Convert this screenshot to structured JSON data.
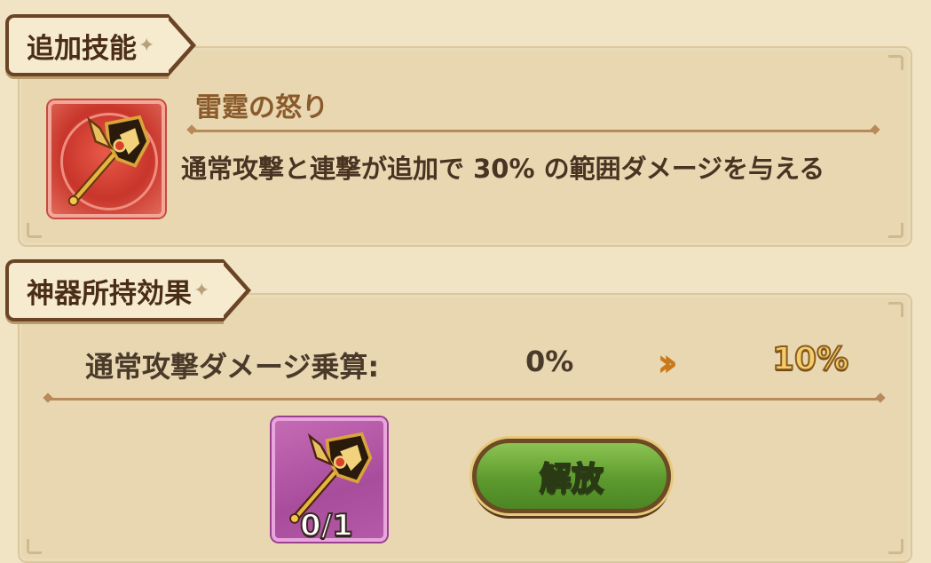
{
  "sections": {
    "skill_title": "追加技能",
    "effect_title": "神器所持効果"
  },
  "skill": {
    "name": "雷霆の怒り",
    "description": "通常攻撃と連撃が追加で 30% の範囲ダメージを与える",
    "icon": "golden-axe-icon"
  },
  "effect": {
    "label": "通常攻撃ダメージ乗算:",
    "current_value": "0%",
    "next_value": "10%",
    "arrow_icon": "double-chevron-right-icon"
  },
  "artifact": {
    "icon": "golden-axe-icon",
    "count": "0/1"
  },
  "button": {
    "release_label": "解放"
  },
  "colors": {
    "background": "#f0e4c4",
    "panel": "#e8d7b1",
    "button_green": "#5d9a2e",
    "arrow_orange": "#c87a1a",
    "next_value_gold": "#f2cd6a"
  }
}
